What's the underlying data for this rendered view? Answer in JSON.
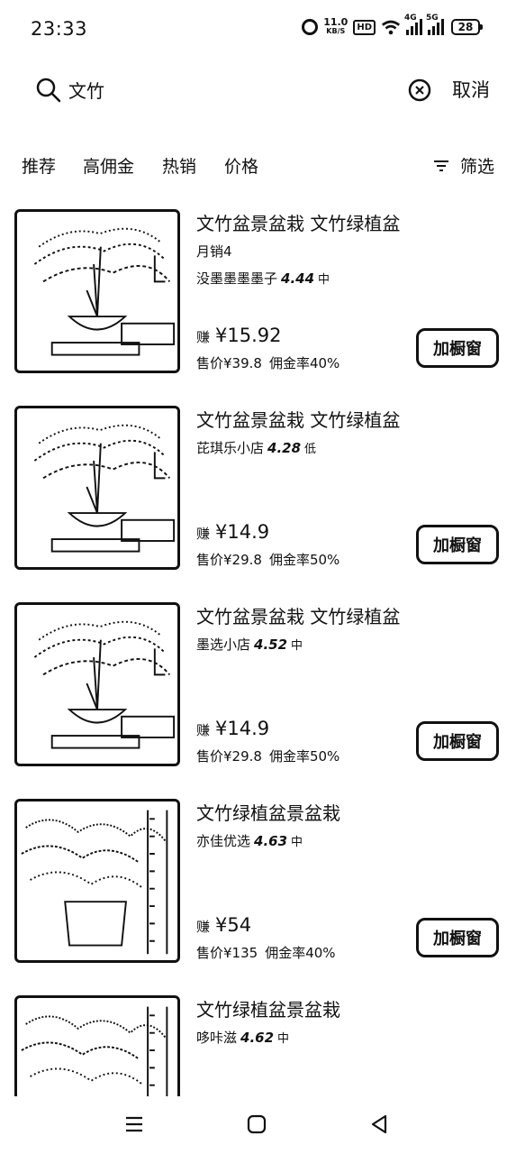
{
  "status_bar": {
    "time": "23:33",
    "net_speed_value": "11.0",
    "net_speed_unit": "KB/S",
    "hd_label": "HD",
    "sim1_label": "4G",
    "sim2_label": "5G",
    "battery": "28",
    "icons": [
      "alarm-icon",
      "wifi-icon",
      "signal-icon",
      "battery-icon"
    ]
  },
  "search": {
    "query": "文竹",
    "cancel_label": "取消"
  },
  "tabs": [
    {
      "label": "推荐"
    },
    {
      "label": "高佣金"
    },
    {
      "label": "热销"
    },
    {
      "label": "价格"
    }
  ],
  "filter_label": "筛选",
  "products": [
    {
      "title": "文竹盆景盆栽 文竹绿植盆",
      "monthly_sales": "月销4",
      "shop": "没墨墨墨墨子",
      "score": "4.44",
      "level": "中",
      "earn_label": "赚",
      "earn": "¥15.92",
      "price": "售价¥39.8",
      "commission": "佣金率40%",
      "button": "加橱窗"
    },
    {
      "title": "文竹盆景盆栽 文竹绿植盆",
      "shop": "芘琪乐小店",
      "score": "4.28",
      "level": "低",
      "earn_label": "赚",
      "earn": "¥14.9",
      "price": "售价¥29.8",
      "commission": "佣金率50%",
      "button": "加橱窗"
    },
    {
      "title": "文竹盆景盆栽 文竹绿植盆",
      "shop": "墨选小店",
      "score": "4.52",
      "level": "中",
      "earn_label": "赚",
      "earn": "¥14.9",
      "price": "售价¥29.8",
      "commission": "佣金率50%",
      "button": "加橱窗"
    },
    {
      "title": "文竹绿植盆景盆栽",
      "shop": "亦佳优选",
      "score": "4.63",
      "level": "中",
      "earn_label": "赚",
      "earn": "¥54",
      "price": "售价¥135",
      "commission": "佣金率40%",
      "button": "加橱窗"
    },
    {
      "title": "文竹绿植盆景盆栽",
      "shop": "哆咔滋",
      "score": "4.62",
      "level": "中"
    }
  ],
  "nav": {
    "icons": [
      "menu-icon",
      "home-icon",
      "back-icon"
    ]
  },
  "colors": {
    "text": "#111111",
    "background": "#ffffff"
  }
}
